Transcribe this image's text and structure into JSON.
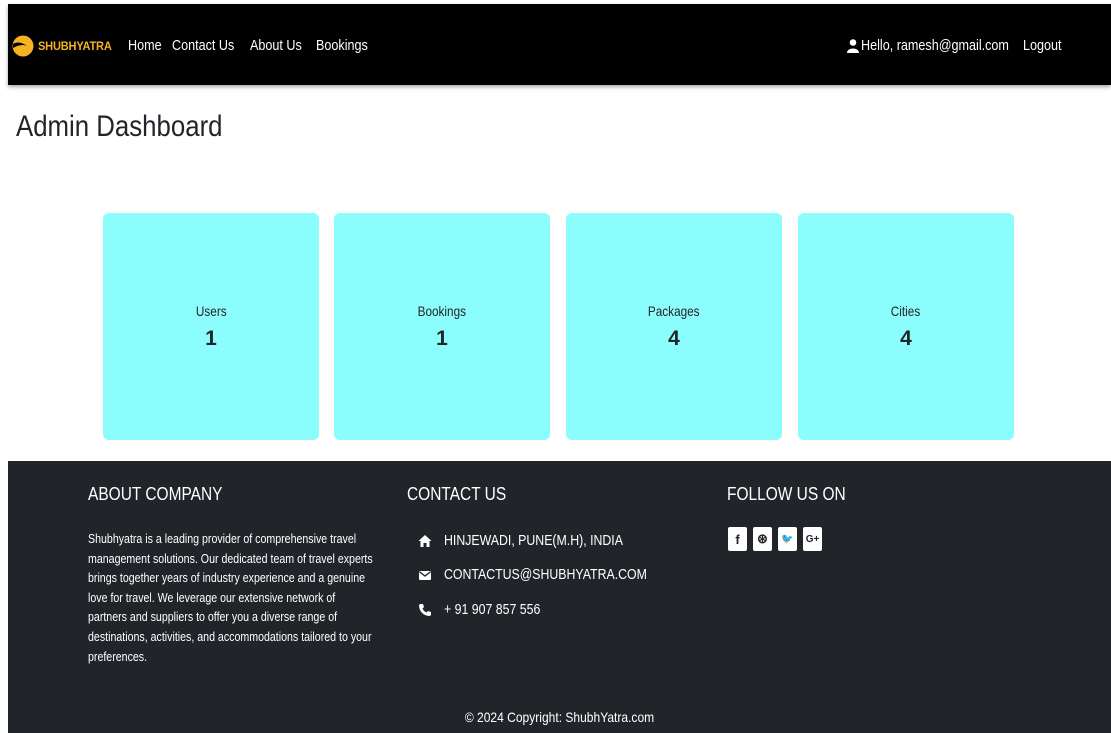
{
  "nav": {
    "brand": "SHUBHYATRA",
    "links": [
      "Home",
      "Contact Us",
      "About Us",
      "Bookings"
    ],
    "greeting": "Hello, ramesh@gmail.com",
    "logout": "Logout"
  },
  "page": {
    "title": "Admin Dashboard"
  },
  "stats": [
    {
      "label": "Users",
      "value": "1"
    },
    {
      "label": "Bookings",
      "value": "1"
    },
    {
      "label": "Packages",
      "value": "4"
    },
    {
      "label": "Cities",
      "value": "4"
    }
  ],
  "footer": {
    "about_heading": "ABOUT COMPANY",
    "about_text": "Shubhyatra is a leading provider of comprehensive travel management solutions. Our dedicated team of travel experts brings together years of industry experience and a genuine love for travel. We leverage our extensive network of partners and suppliers to offer you a diverse range of destinations, activities, and accommodations tailored to your preferences.",
    "contact_heading": "CONTACT US",
    "address": "HINJEWADI, PUNE(M.H), INDIA",
    "email": "CONTACTUS@SHUBHYATRA.COM",
    "phone": "+ 91 907 857 556",
    "follow_heading": "FOLLOW US ON",
    "social": [
      {
        "icon": "facebook-icon",
        "glyph": "f"
      },
      {
        "icon": "dribbble-icon",
        "glyph": "⊛"
      },
      {
        "icon": "twitter-icon",
        "glyph": "🐦"
      },
      {
        "icon": "google-plus-icon",
        "glyph": "G+"
      }
    ],
    "copyright": "© 2024 Copyright: ShubhYatra.com"
  },
  "colors": {
    "nav_bg": "#000000",
    "brand": "#f5b324",
    "card_bg": "#8cfdfd",
    "footer_bg": "#212529"
  }
}
